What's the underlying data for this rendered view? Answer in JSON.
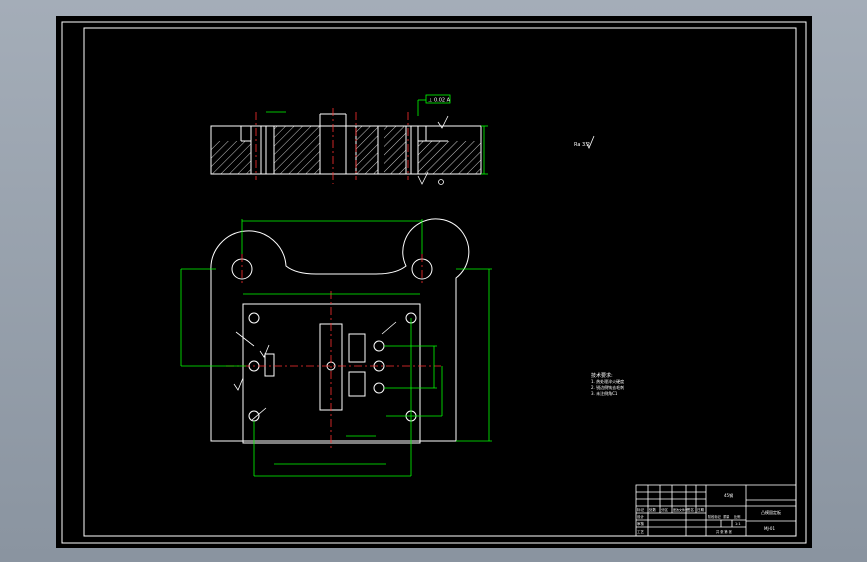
{
  "viewport": {
    "background": "#000000"
  },
  "colors": {
    "frame": "#ffffff",
    "part": "#ffffff",
    "dimension": "#00ff00",
    "center": "#ff3030",
    "tolerance_box": "#00ff00",
    "annotation": "#ffffff"
  },
  "drawing": {
    "section_view_label": "A-A",
    "roughness_right": "Ra 1.6",
    "roughness_top": "Ra 3.2",
    "tolerance_frame": "⊥ 0.02 A",
    "notes": {
      "heading": "技术要求:",
      "lines": [
        "1. 热处理淬火硬度",
        "2. 锐边倒钝去毛刺",
        "3. 未注倒角C1"
      ]
    },
    "title_block": {
      "part_name": "凸模固定板",
      "material": "45钢",
      "scale": "1:1",
      "drawing_no": "MJ-01",
      "header_cells": [
        "标记",
        "处数",
        "分区",
        "更改文件号",
        "签名",
        "日期"
      ],
      "rows": [
        "设计",
        "审核",
        "工艺"
      ],
      "labels": [
        "阶段标记",
        "重量",
        "比例"
      ],
      "sheet": "共 张 第 张"
    }
  }
}
